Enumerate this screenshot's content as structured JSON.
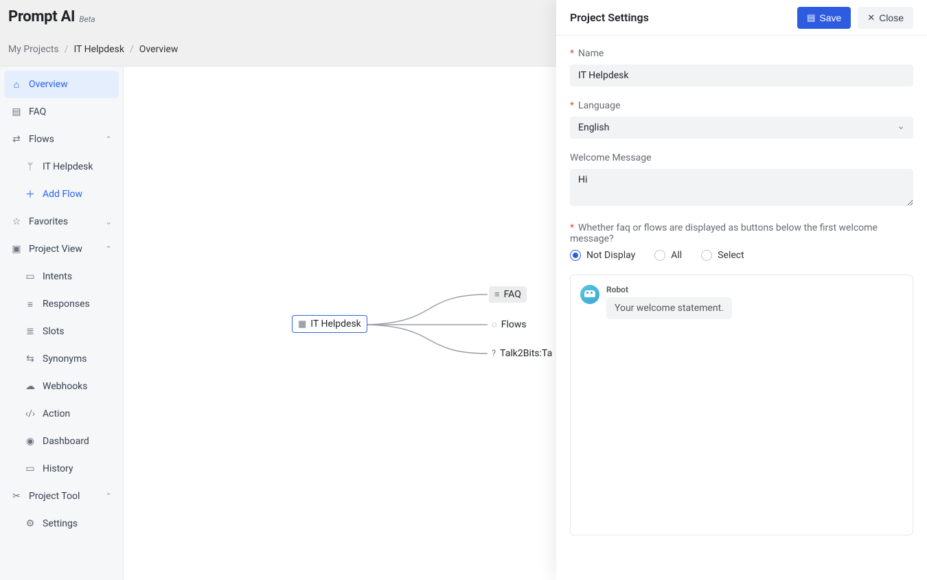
{
  "header": {
    "title": "Prompt AI",
    "badge": "Beta"
  },
  "breadcrumb": {
    "root": "My Projects",
    "project": "IT Helpdesk",
    "page": "Overview"
  },
  "sidebar": {
    "overview": "Overview",
    "faq": "FAQ",
    "flows": "Flows",
    "flow_item": "IT Helpdesk",
    "add_flow": "Add Flow",
    "favorites": "Favorites",
    "project_view": "Project View",
    "intents": "Intents",
    "responses": "Responses",
    "slots": "Slots",
    "synonyms": "Synonyms",
    "webhooks": "Webhooks",
    "action": "Action",
    "dashboard": "Dashboard",
    "history": "History",
    "project_tool": "Project Tool",
    "settings": "Settings"
  },
  "canvas": {
    "root": "IT Helpdesk",
    "faq": "FAQ",
    "flows": "Flows",
    "talk2bits": "Talk2Bits:Ta"
  },
  "drawer": {
    "title": "Project Settings",
    "save": "Save",
    "close": "Close",
    "name_label": "Name",
    "name_value": "IT Helpdesk",
    "language_label": "Language",
    "language_value": "English",
    "welcome_label": "Welcome Message",
    "welcome_value": "Hi",
    "display_label": "Whether faq or flows are displayed as buttons below the first welcome message?",
    "radio_not_display": "Not Display",
    "radio_all": "All",
    "radio_select": "Select",
    "robot_name": "Robot",
    "robot_bubble": "Your welcome statement."
  }
}
